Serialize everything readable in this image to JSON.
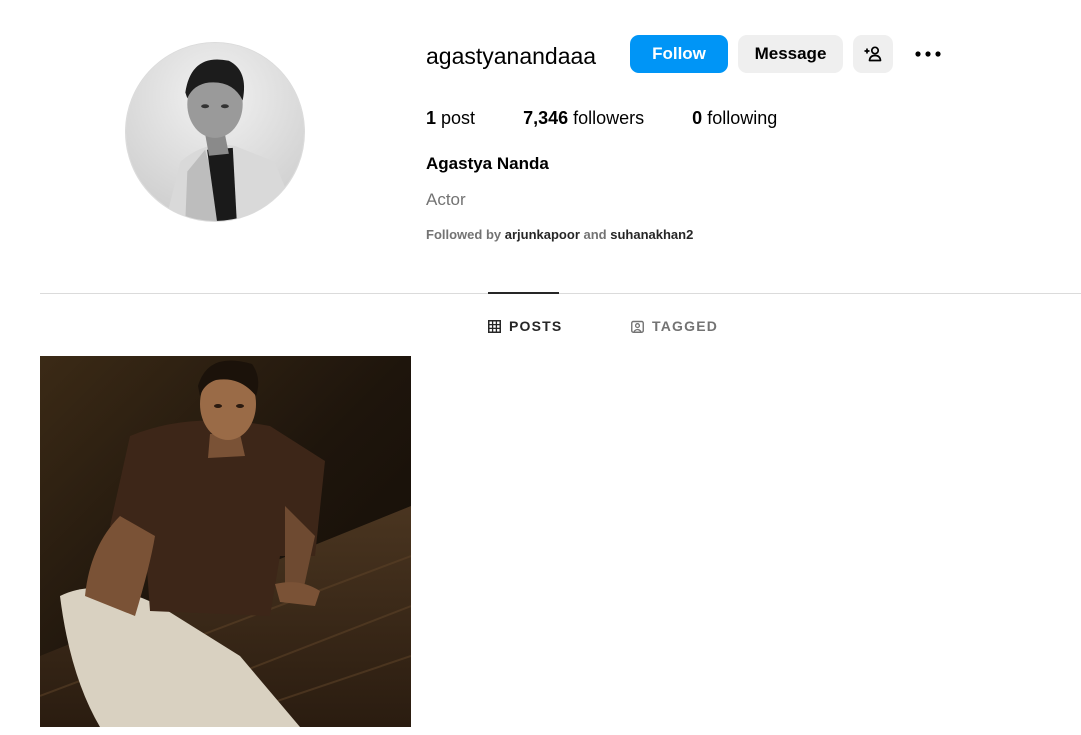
{
  "profile": {
    "username": "agastyanandaaa",
    "full_name": "Agastya Nanda",
    "bio": "Actor",
    "followed_by": {
      "prefix": "Followed by",
      "first": "arjunkapoor",
      "joiner": "and",
      "second": "suhanakhan2"
    }
  },
  "actions": {
    "follow_label": "Follow",
    "message_label": "Message",
    "suggest_icon": "add-person-icon",
    "more_icon": "more-horizontal-icon"
  },
  "stats": {
    "posts_count": "1",
    "posts_label": "post",
    "followers_count": "7,346",
    "followers_label": "followers",
    "following_count": "0",
    "following_label": "following"
  },
  "tabs": [
    {
      "label": "POSTS",
      "icon": "grid-icon",
      "active": true
    },
    {
      "label": "TAGGED",
      "icon": "tagged-icon",
      "active": false
    }
  ],
  "colors": {
    "accent": "#0095f6",
    "secondary_button": "#efefef",
    "muted_text": "#737373",
    "divider": "#dbdbdb"
  }
}
